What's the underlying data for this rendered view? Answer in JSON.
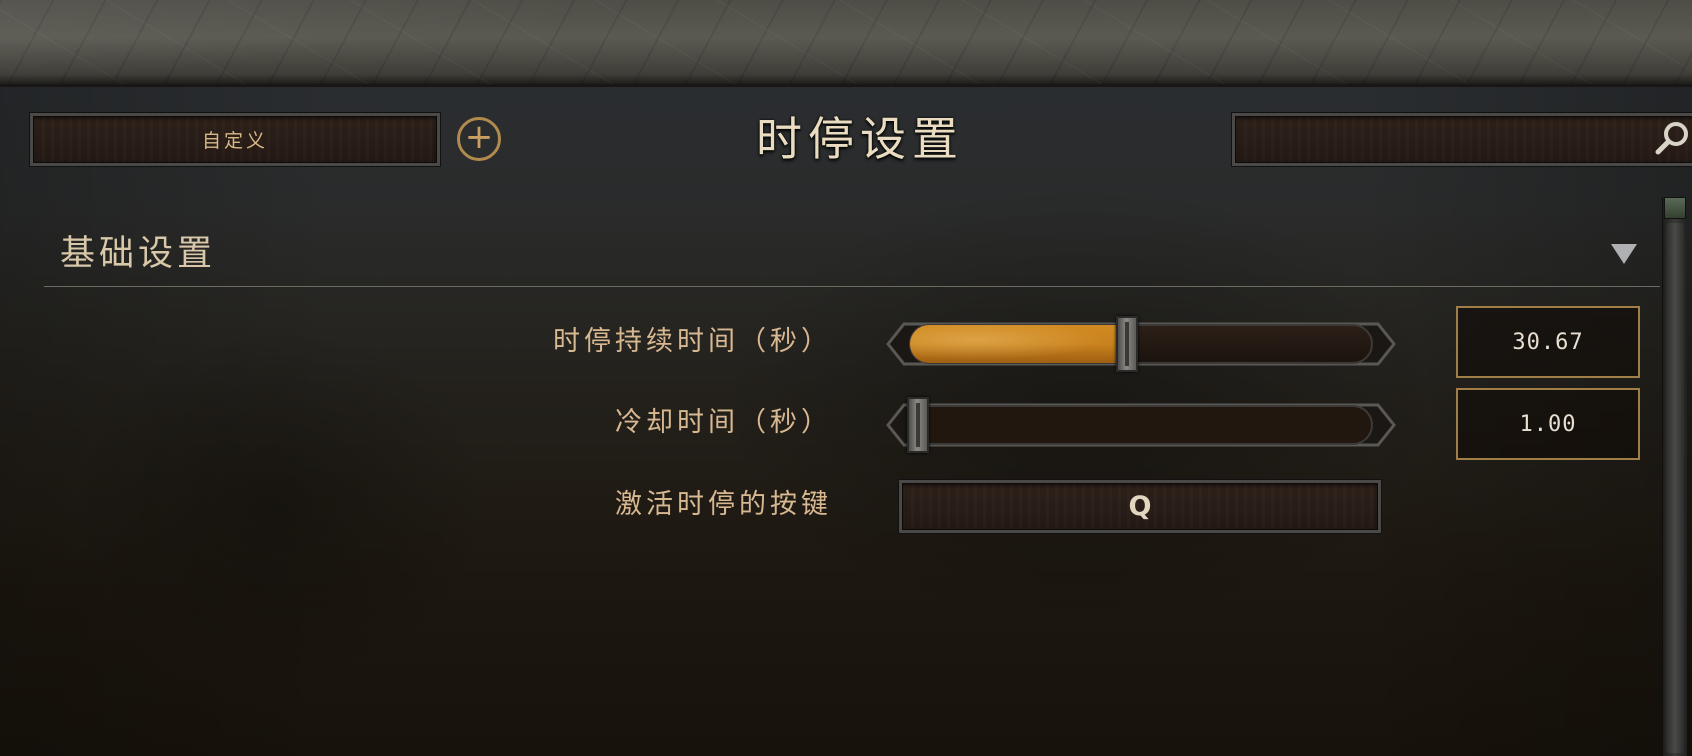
{
  "header": {
    "preset_label": "自定义",
    "add_symbol": "+",
    "title": "时停设置",
    "search_value": ""
  },
  "section": {
    "title": "基础设置"
  },
  "settings": [
    {
      "label": "时停持续时间（秒）",
      "value": "30.67",
      "fill_fraction": 0.47
    },
    {
      "label": "冷却时间（秒）",
      "value": "1.00",
      "fill_fraction": 0.0
    },
    {
      "label": "激活时停的按键",
      "key": "Q"
    }
  ],
  "icons": {
    "add": "plus-circle-icon",
    "search": "magnifier-icon",
    "collapse": "triangle-down-icon"
  },
  "colors": {
    "accent_gold": "#b08a4e",
    "label_tan": "#d7b891",
    "slider_fill": "#c9821e",
    "title_cream": "#eadcc0"
  }
}
